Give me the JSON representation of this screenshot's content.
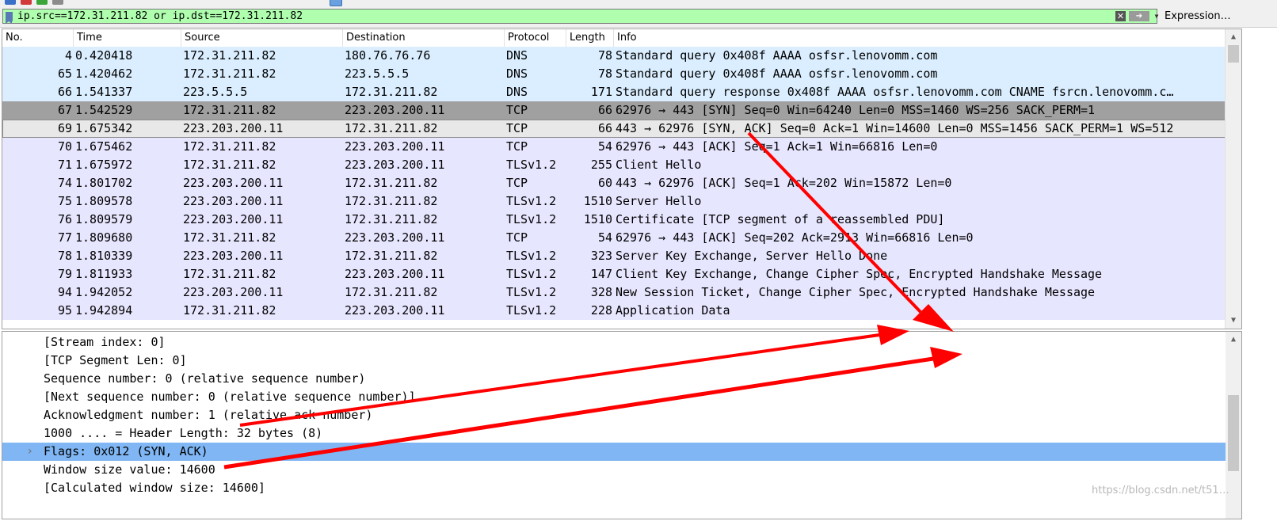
{
  "filter": {
    "value": "ip.src==172.31.211.82 or ip.dst==172.31.211.82",
    "clear_glyph": "✕",
    "apply_glyph": "➔",
    "dropdown_glyph": "▼",
    "expression_label": "Expression…"
  },
  "packet_list": {
    "columns": [
      "No.",
      "Time",
      "Source",
      "Destination",
      "Protocol",
      "Length",
      "Info"
    ],
    "rows": [
      {
        "no": "4",
        "time": "0.420418",
        "src": "172.31.211.82",
        "dst": "180.76.76.76",
        "proto": "DNS",
        "len": "78",
        "info": "Standard query 0x408f AAAA osfsr.lenovomm.com"
      },
      {
        "no": "65",
        "time": "1.420462",
        "src": "172.31.211.82",
        "dst": "223.5.5.5",
        "proto": "DNS",
        "len": "78",
        "info": "Standard query 0x408f AAAA osfsr.lenovomm.com"
      },
      {
        "no": "66",
        "time": "1.541337",
        "src": "223.5.5.5",
        "dst": "172.31.211.82",
        "proto": "DNS",
        "len": "171",
        "info": "Standard query response 0x408f AAAA osfsr.lenovomm.com CNAME fsrcn.lenovomm.c…"
      },
      {
        "no": "67",
        "time": "1.542529",
        "src": "172.31.211.82",
        "dst": "223.203.200.11",
        "proto": "TCP",
        "len": "66",
        "info": "62976 → 443 [SYN] Seq=0 Win=64240 Len=0 MSS=1460 WS=256 SACK_PERM=1"
      },
      {
        "no": "69",
        "time": "1.675342",
        "src": "223.203.200.11",
        "dst": "172.31.211.82",
        "proto": "TCP",
        "len": "66",
        "info": "443 → 62976 [SYN, ACK] Seq=0 Ack=1 Win=14600 Len=0 MSS=1456 SACK_PERM=1 WS=512"
      },
      {
        "no": "70",
        "time": "1.675462",
        "src": "172.31.211.82",
        "dst": "223.203.200.11",
        "proto": "TCP",
        "len": "54",
        "info": "62976 → 443 [ACK] Seq=1 Ack=1 Win=66816 Len=0"
      },
      {
        "no": "71",
        "time": "1.675972",
        "src": "172.31.211.82",
        "dst": "223.203.200.11",
        "proto": "TLSv1.2",
        "len": "255",
        "info": "Client Hello"
      },
      {
        "no": "74",
        "time": "1.801702",
        "src": "223.203.200.11",
        "dst": "172.31.211.82",
        "proto": "TCP",
        "len": "60",
        "info": "443 → 62976 [ACK] Seq=1 Ack=202 Win=15872 Len=0"
      },
      {
        "no": "75",
        "time": "1.809578",
        "src": "223.203.200.11",
        "dst": "172.31.211.82",
        "proto": "TLSv1.2",
        "len": "1510",
        "info": "Server Hello"
      },
      {
        "no": "76",
        "time": "1.809579",
        "src": "223.203.200.11",
        "dst": "172.31.211.82",
        "proto": "TLSv1.2",
        "len": "1510",
        "info": "Certificate [TCP segment of a reassembled PDU]"
      },
      {
        "no": "77",
        "time": "1.809680",
        "src": "172.31.211.82",
        "dst": "223.203.200.11",
        "proto": "TCP",
        "len": "54",
        "info": "62976 → 443 [ACK] Seq=202 Ack=2913 Win=66816 Len=0"
      },
      {
        "no": "78",
        "time": "1.810339",
        "src": "223.203.200.11",
        "dst": "172.31.211.82",
        "proto": "TLSv1.2",
        "len": "323",
        "info": "Server Key Exchange, Server Hello Done"
      },
      {
        "no": "79",
        "time": "1.811933",
        "src": "172.31.211.82",
        "dst": "223.203.200.11",
        "proto": "TLSv1.2",
        "len": "147",
        "info": "Client Key Exchange, Change Cipher Spec, Encrypted Handshake Message"
      },
      {
        "no": "94",
        "time": "1.942052",
        "src": "223.203.200.11",
        "dst": "172.31.211.82",
        "proto": "TLSv1.2",
        "len": "328",
        "info": "New Session Ticket, Change Cipher Spec, Encrypted Handshake Message"
      },
      {
        "no": "95",
        "time": "1.942894",
        "src": "172.31.211.82",
        "dst": "223.203.200.11",
        "proto": "TLSv1.2",
        "len": "228",
        "info": "Application Data"
      }
    ]
  },
  "details": {
    "lines": [
      "[Stream index: 0]",
      "[TCP Segment Len: 0]",
      "Sequence number: 0    (relative sequence number)",
      "[Next sequence number: 0    (relative sequence number)]",
      "Acknowledgment number: 1    (relative ack number)",
      "1000 .... = Header Length: 32 bytes (8)",
      "Flags: 0x012 (SYN, ACK)",
      "Window size value: 14600",
      "[Calculated window size: 14600]"
    ],
    "expander_glyph": "›"
  },
  "scroll": {
    "up": "▲",
    "down": "▼"
  },
  "watermark": "https://blog.csdn.net/t51…",
  "colors": {
    "filter_valid": "#afffaf",
    "dns_row": "#daeeff",
    "tcp_row": "#e7e6ff",
    "selected_row": "#a0a0a0",
    "detail_selected": "#7fb6f3",
    "annotation_arrow": "#ff0000"
  }
}
